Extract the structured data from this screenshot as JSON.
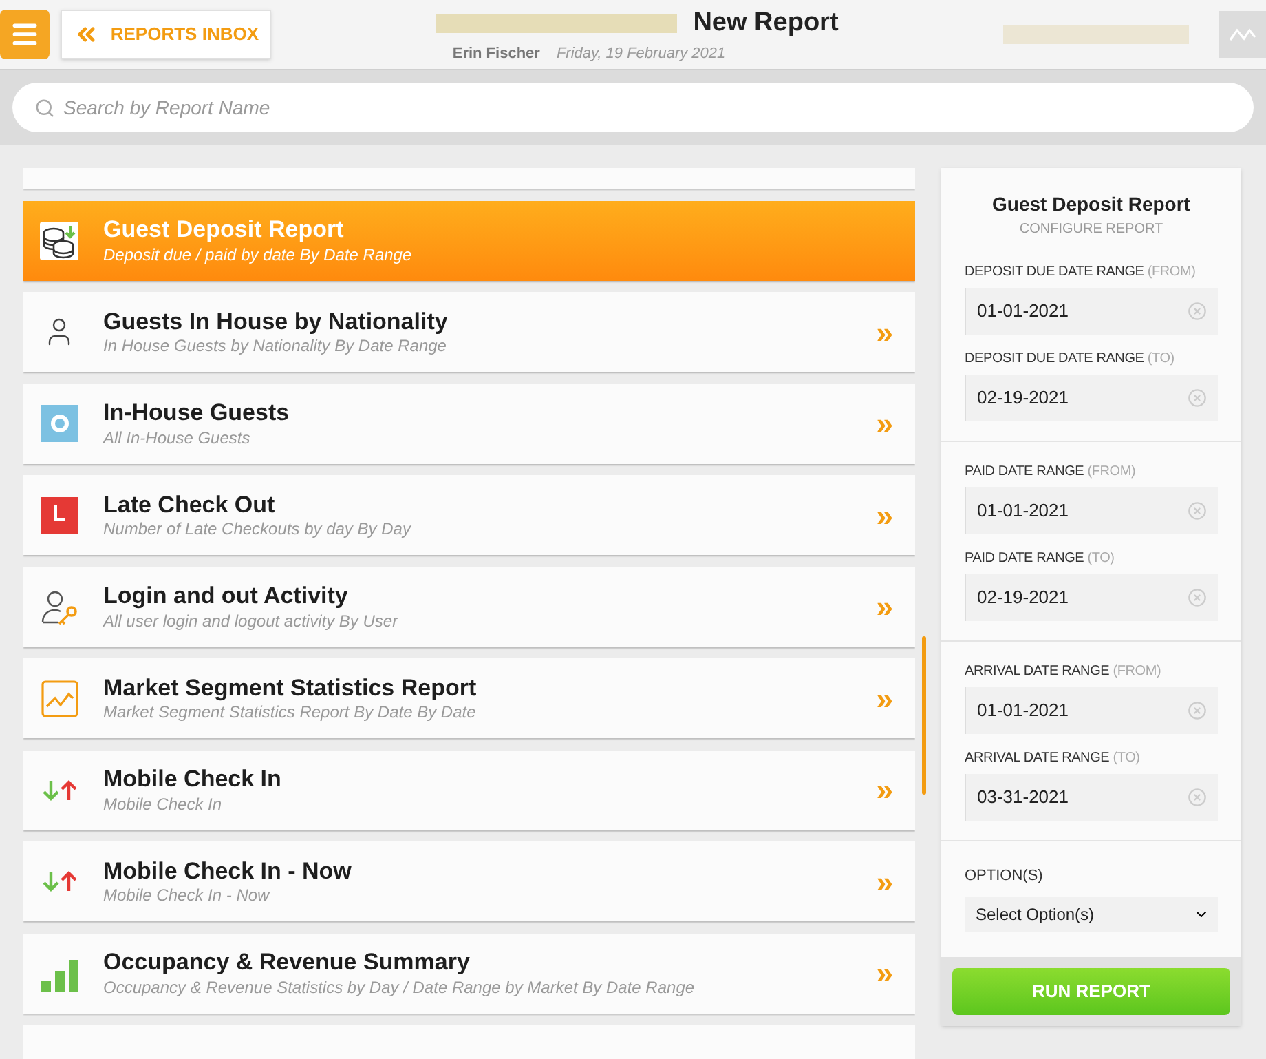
{
  "header": {
    "back_button": "REPORTS INBOX",
    "title": "New Report",
    "user": "Erin Fischer",
    "date": "Friday, 19 February 2021"
  },
  "search": {
    "placeholder": "Search by Report Name"
  },
  "reports": [
    {
      "title": "Guest Deposit Report",
      "subtitle": "Deposit due / paid by date By Date Range",
      "kind": "coins",
      "selected": true
    },
    {
      "title": "Guests In House by Nationality",
      "subtitle": "In House Guests by Nationality By Date Range",
      "kind": "person",
      "selected": false,
      "arrow": "»"
    },
    {
      "title": "In-House Guests",
      "subtitle": "All In-House Guests",
      "kind": "ring",
      "selected": false,
      "arrow": "»"
    },
    {
      "title": "Late Check Out",
      "subtitle": "Number of Late Checkouts by day By Day",
      "kind": "letter",
      "icon_text": "L",
      "selected": false,
      "arrow": "»"
    },
    {
      "title": "Login and out Activity",
      "subtitle": "All user login and logout activity By User",
      "kind": "userkey",
      "selected": false,
      "arrow": "»"
    },
    {
      "title": "Market Segment Statistics Report",
      "subtitle": "Market Segment Statistics Report By Date By Date",
      "kind": "linechart",
      "selected": false,
      "arrow": "»"
    },
    {
      "title": "Mobile Check In",
      "subtitle": "Mobile Check In",
      "kind": "arrows",
      "selected": false,
      "arrow": "»"
    },
    {
      "title": "Mobile Check In - Now",
      "subtitle": "Mobile Check In - Now",
      "kind": "arrows",
      "selected": false,
      "arrow": "»"
    },
    {
      "title": "Occupancy & Revenue Summary",
      "subtitle": "Occupancy & Revenue Statistics by Day / Date Range by Market By Date Range",
      "kind": "bars",
      "selected": false,
      "arrow": "»"
    }
  ],
  "config": {
    "title": "Guest Deposit Report",
    "subtitle": "CONFIGURE REPORT",
    "sections": [
      {
        "fields": [
          {
            "label": "DEPOSIT DUE DATE RANGE",
            "suffix": "(FROM)",
            "value": "01-01-2021"
          },
          {
            "label": "DEPOSIT DUE DATE RANGE",
            "suffix": "(TO)",
            "value": "02-19-2021"
          }
        ]
      },
      {
        "fields": [
          {
            "label": "PAID DATE RANGE",
            "suffix": "(FROM)",
            "value": "01-01-2021"
          },
          {
            "label": "PAID DATE RANGE",
            "suffix": "(TO)",
            "value": "02-19-2021"
          }
        ]
      },
      {
        "fields": [
          {
            "label": "ARRIVAL DATE RANGE",
            "suffix": "(FROM)",
            "value": "01-01-2021"
          },
          {
            "label": "ARRIVAL DATE RANGE",
            "suffix": "(TO)",
            "value": "03-31-2021"
          }
        ]
      }
    ],
    "options": {
      "label": "OPTION(S)",
      "placeholder": "Select Option(s)"
    },
    "run_button": "RUN REPORT"
  }
}
